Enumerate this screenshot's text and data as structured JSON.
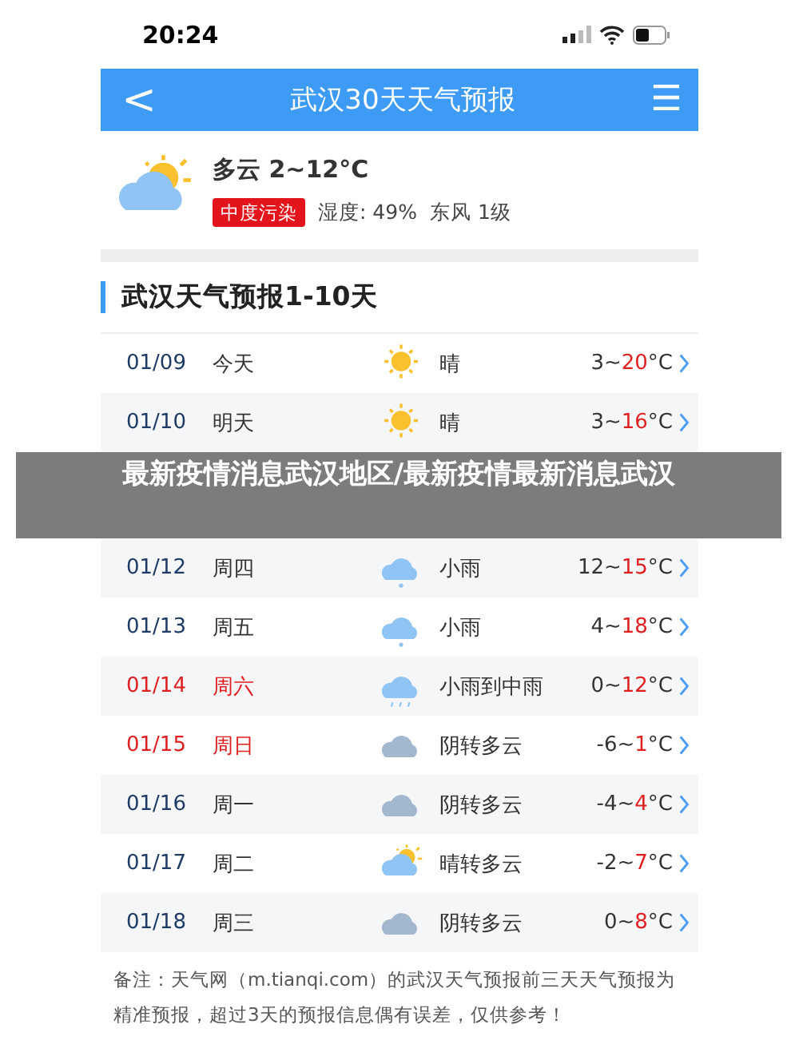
{
  "status_bar": {
    "time": "20:24"
  },
  "header": {
    "back": "<",
    "title": "武汉30天天气预报",
    "menu": "☰"
  },
  "current": {
    "kind": "cloudy_sun",
    "summary": "多云 2~12°C",
    "aqi": "中度污染",
    "humidity": "湿度: 49%",
    "wind": "东风 1级"
  },
  "section_title": "武汉天气预报1-10天",
  "rows": [
    {
      "date": "01/09",
      "day": "今天",
      "weekend": false,
      "kind": "sunny",
      "weather": "晴",
      "low": "3~",
      "high": "20",
      "unit": "°C"
    },
    {
      "date": "01/10",
      "day": "明天",
      "weekend": false,
      "kind": "sunny",
      "weather": "晴",
      "low": "3~",
      "high": "16",
      "unit": "°C"
    },
    {
      "kind": "banner",
      "text": "最新疫情消息武汉地区/最新疫情最新消息武汉"
    },
    {
      "date": "01/12",
      "day": "周四",
      "weekend": false,
      "kind": "light_rain",
      "weather": "小雨",
      "low": "12~",
      "high": "15",
      "unit": "°C"
    },
    {
      "date": "01/13",
      "day": "周五",
      "weekend": false,
      "kind": "light_rain",
      "weather": "小雨",
      "low": "4~",
      "high": "18",
      "unit": "°C"
    },
    {
      "date": "01/14",
      "day": "周六",
      "weekend": true,
      "kind": "moderate_rain",
      "weather": "小雨到中雨",
      "low": "0~",
      "high": "12",
      "unit": "°C"
    },
    {
      "date": "01/15",
      "day": "周日",
      "weekend": true,
      "kind": "overcast",
      "weather": "阴转多云",
      "low": "-6~",
      "high": "1",
      "unit": "°C"
    },
    {
      "date": "01/16",
      "day": "周一",
      "weekend": false,
      "kind": "overcast",
      "weather": "阴转多云",
      "low": "-4~",
      "high": "4",
      "unit": "°C"
    },
    {
      "date": "01/17",
      "day": "周二",
      "weekend": false,
      "kind": "cloudy_sun",
      "weather": "晴转多云",
      "low": "-2~",
      "high": "7",
      "unit": "°C"
    },
    {
      "date": "01/18",
      "day": "周三",
      "weekend": false,
      "kind": "overcast",
      "weather": "阴转多云",
      "low": "0~",
      "high": "8",
      "unit": "°C"
    }
  ],
  "note": "备注：天气网（m.tianqi.com）的武汉天气预报前三天天气预报为精准预报，超过3天的预报信息偶有误差，仅供参考！"
}
